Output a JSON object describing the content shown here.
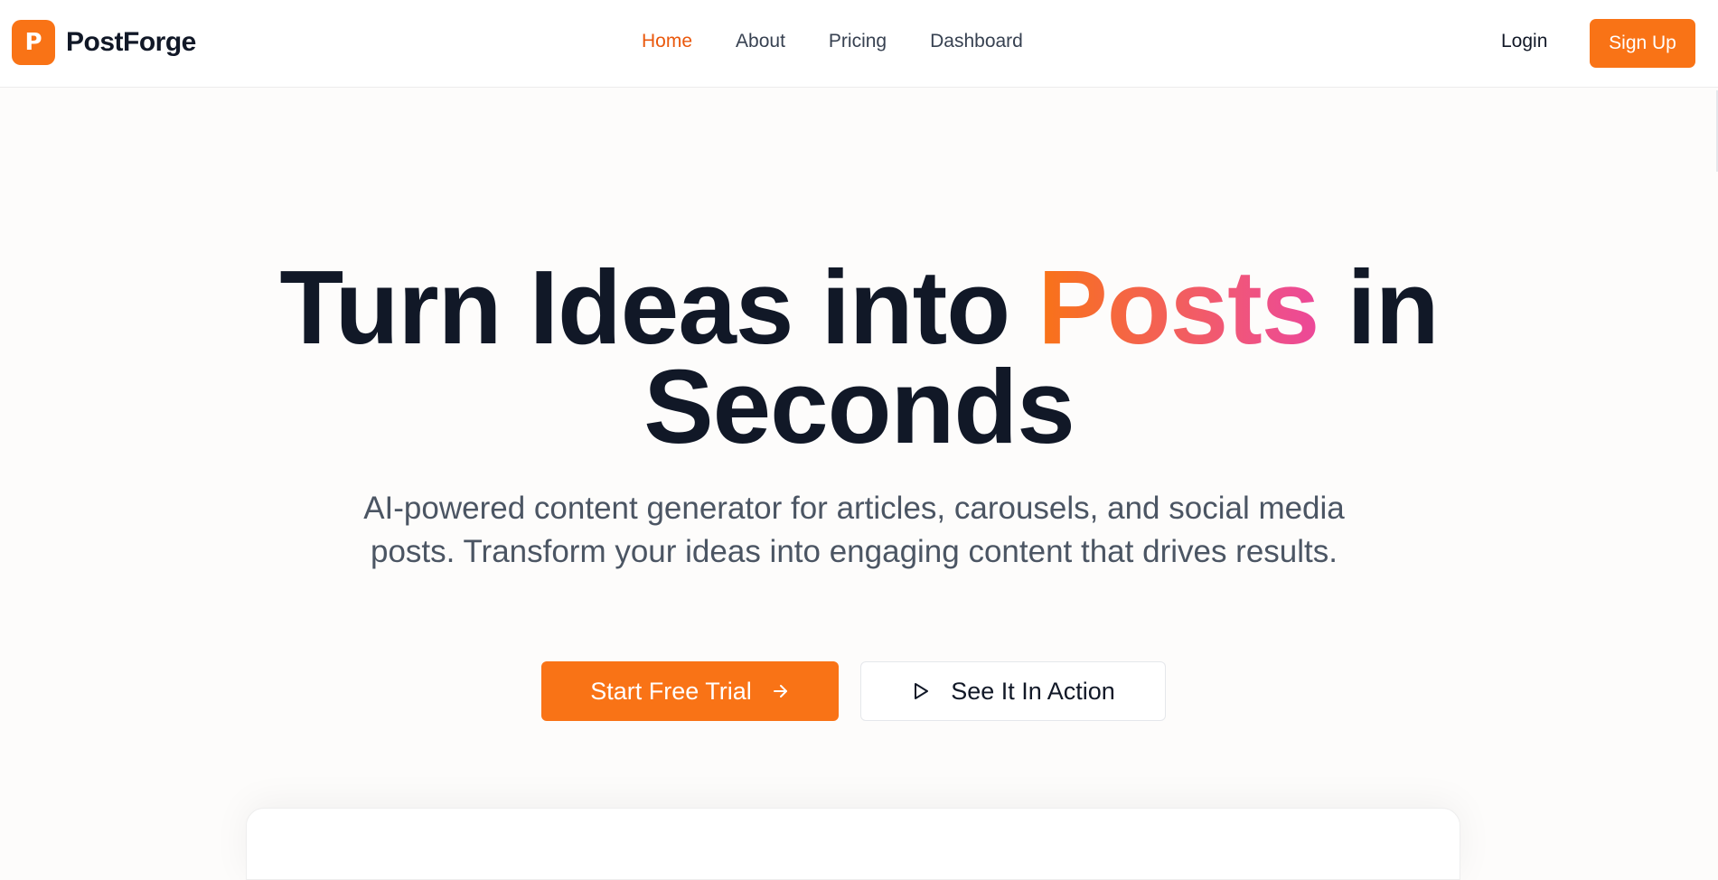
{
  "brand": {
    "logo_letter": "P",
    "name": "PostForge",
    "accent_color": "#f97316"
  },
  "nav": {
    "links": [
      {
        "label": "Home",
        "active": true
      },
      {
        "label": "About",
        "active": false
      },
      {
        "label": "Pricing",
        "active": false
      },
      {
        "label": "Dashboard",
        "active": false
      }
    ],
    "login_label": "Login",
    "signup_label": "Sign Up"
  },
  "hero": {
    "headline_part1": "Turn Ideas into ",
    "headline_accent": "Posts",
    "headline_part2": " in",
    "headline_line2": "Seconds",
    "subtitle": "AI-powered content generator for articles, carousels, and social media posts. Transform your ideas into engaging content that drives results.",
    "primary_cta": {
      "label": "Start Free Trial",
      "icon": "arrow-right-icon"
    },
    "secondary_cta": {
      "label": "See It In Action",
      "icon": "play-icon"
    }
  }
}
